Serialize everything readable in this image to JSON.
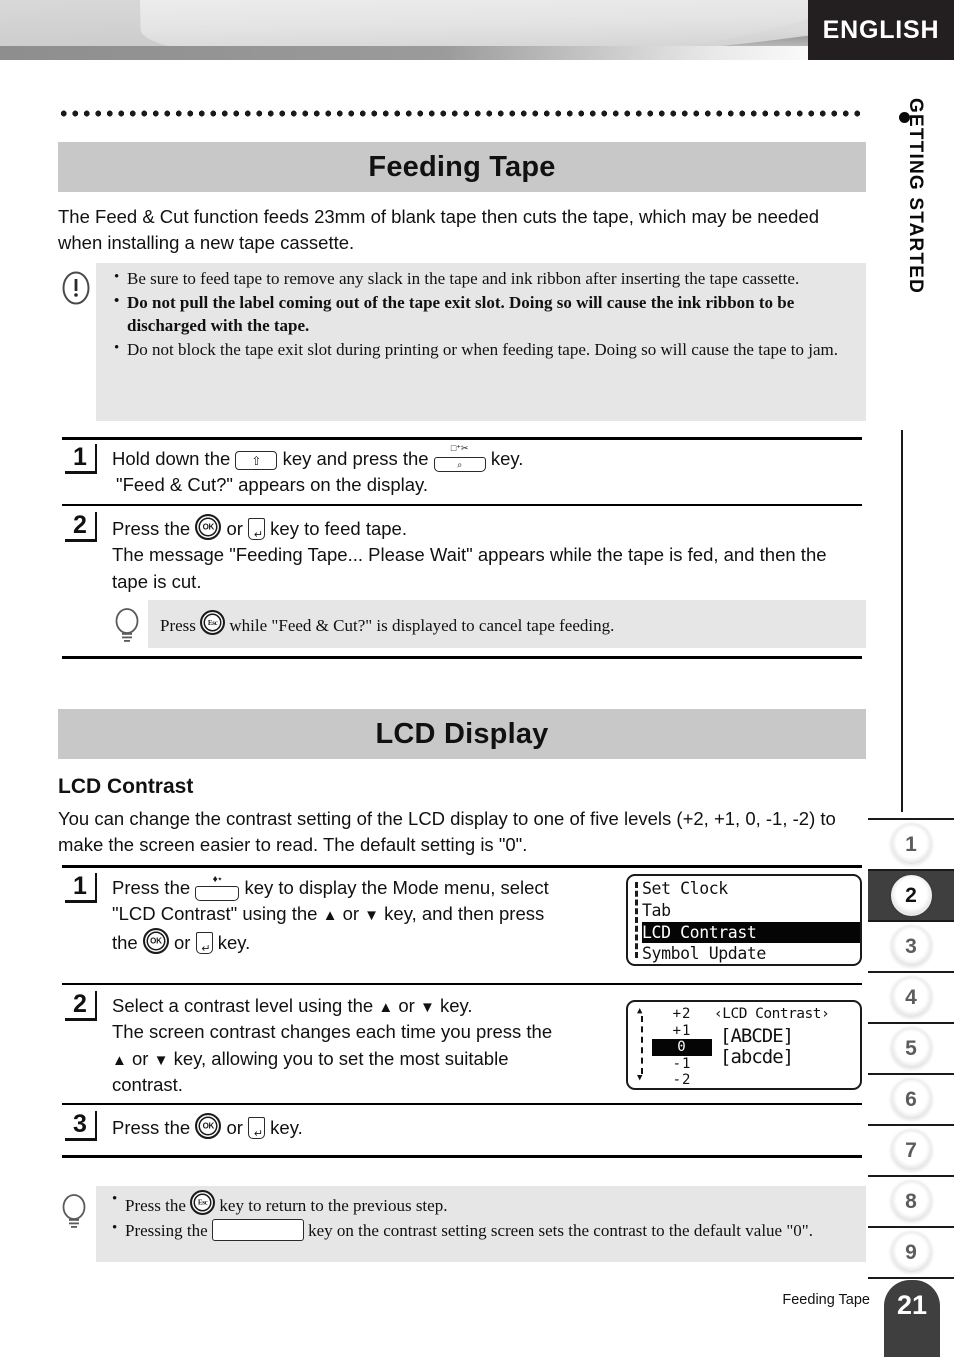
{
  "header": {
    "language_tab": "ENGLISH",
    "chapter_label": "GETTING STARTED",
    "chapter_bullet": "bullet-dot"
  },
  "sections": [
    {
      "id": "feeding-tape",
      "title": "Feeding Tape",
      "intro": "The Feed & Cut function feeds 23mm of blank tape then cuts the tape, which may be needed when installing a new tape cassette.",
      "warning": {
        "icon": "exclamation-icon",
        "items": [
          {
            "text": "Be sure to feed tape to remove any slack in the tape and ink ribbon after inserting the tape cassette.",
            "bold": false
          },
          {
            "text": "Do not pull the label coming out of the tape exit slot. Doing so will cause the ink ribbon to be discharged with the tape.",
            "bold": true
          },
          {
            "text": "Do not block the tape exit slot during printing or when feeding tape. Doing so will cause the tape to jam.",
            "bold": false
          }
        ]
      },
      "steps": [
        {
          "number": "1",
          "line1_a": "Hold down the",
          "line1_key1": "shift-key",
          "line1_b": "key and press the",
          "line1_key2": "feed-and-cut-key",
          "line1_c": "key.",
          "line2": "\"Feed & Cut?\" appears on the display."
        },
        {
          "number": "2",
          "line1_a": "Press the",
          "line1_key1": "ok-key",
          "line1_b": "or",
          "line1_key2": "enter-key",
          "line1_c": "key to feed tape.",
          "line2": "The message \"Feeding Tape... Please Wait\" appears while the tape is fed, and then the tape is cut."
        }
      ],
      "tip": {
        "icon": "lightbulb-icon",
        "text_a": "Press",
        "key": "esc-key",
        "text_b": "while \"Feed & Cut?\" is displayed to cancel tape feeding."
      }
    },
    {
      "id": "lcd-display",
      "title": "LCD Display",
      "subheading": "LCD Contrast",
      "intro": "You can change the contrast setting of the LCD display to one of five levels (+2, +1, 0, -1, -2) to make the screen easier to read. The default setting is \"0\".",
      "steps": [
        {
          "number": "1",
          "line1_a": "Press the",
          "key_mode": "mode-key",
          "line1_b": "key to display the Mode menu, select",
          "line2_a": "\"LCD Contrast\" using the",
          "arrow_up": "up-arrow-key",
          "line2_or": "or",
          "arrow_down": "down-arrow-key",
          "line2_b": "key, and then press",
          "line3_a": "the",
          "key_ok": "ok-key",
          "line3_or": "or",
          "key_enter": "enter-key",
          "line3_b": "key."
        },
        {
          "number": "2",
          "line1_a": "Select a contrast level using the",
          "arrow_up": "up-arrow-key",
          "line1_or": "or",
          "arrow_down": "down-arrow-key",
          "line1_b": "key.",
          "line2": "The screen contrast changes each time you press the",
          "line3_or": "or",
          "line3_b": "key, allowing you to set the most suitable",
          "line4": "contrast."
        },
        {
          "number": "3",
          "line1_a": "Press the",
          "key_ok": "ok-key",
          "line1_or": "or",
          "key_enter": "enter-key",
          "line1_b": "key."
        }
      ],
      "tip": {
        "icon": "lightbulb-icon",
        "items": [
          {
            "text_a": "Press the",
            "key": "esc-key",
            "text_b": "key to return to the previous step."
          },
          {
            "text_a": "Pressing the",
            "key": "blank-key",
            "text_b": "key on the contrast setting screen sets the contrast to the default value \"0\"."
          }
        ]
      }
    }
  ],
  "lcd_menu_screen": {
    "rows": [
      {
        "label": "Set Clock",
        "selected": false
      },
      {
        "label": "Tab",
        "selected": false
      },
      {
        "label": "LCD Contrast",
        "selected": true
      },
      {
        "label": "Symbol Update",
        "selected": false
      }
    ]
  },
  "lcd_contrast_screen": {
    "title": "‹LCD Contrast›",
    "levels": [
      {
        "label": "+2",
        "selected": false
      },
      {
        "label": "+1",
        "selected": false
      },
      {
        "label": "0",
        "selected": true
      },
      {
        "label": "-1",
        "selected": false
      },
      {
        "label": "-2",
        "selected": false
      }
    ],
    "sample_upper": "[ABCDE]",
    "sample_lower": "[abcde]",
    "scroll_up": "▲",
    "scroll_down": "▼"
  },
  "side_tabs": [
    {
      "label": "1",
      "active": false
    },
    {
      "label": "2",
      "active": true
    },
    {
      "label": "3",
      "active": false
    },
    {
      "label": "4",
      "active": false
    },
    {
      "label": "5",
      "active": false
    },
    {
      "label": "6",
      "active": false
    },
    {
      "label": "7",
      "active": false
    },
    {
      "label": "8",
      "active": false
    },
    {
      "label": "9",
      "active": false
    }
  ],
  "footer": {
    "running_title": "Feeding Tape",
    "page_number": "21"
  },
  "colors": {
    "band_gray": "#c8c8c8",
    "note_gray": "#e6e6e6",
    "dark": "#3f3f3f",
    "black": "#231f20"
  }
}
